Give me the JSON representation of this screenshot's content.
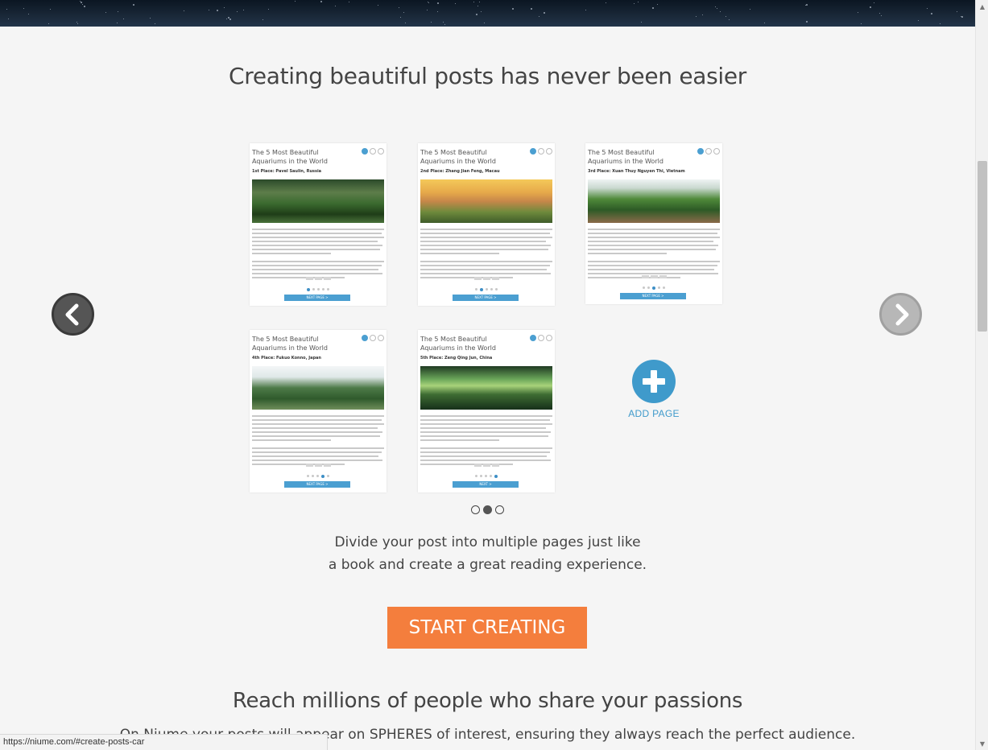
{
  "hero": {
    "label": ""
  },
  "main": {
    "title": "Creating beautiful posts has never been easier",
    "description_line1": "Divide your post into multiple pages just like",
    "description_line2": "a book and create a great reading experience.",
    "cta_label": "START CREATING",
    "add_page_label": "ADD PAGE"
  },
  "cards": [
    {
      "title": "The 5 Most Beautiful Aquariums in the World",
      "subtitle": "1st Place: Pavel Saulin, Russia",
      "button": "NEXT PAGE >",
      "active_dot": 0
    },
    {
      "title": "The 5 Most Beautiful Aquariums in the World",
      "subtitle": "2nd Place: Zhang Jian Feng, Macau",
      "button": "NEXT PAGE >",
      "active_dot": 1
    },
    {
      "title": "The 5 Most Beautiful Aquariums in the World",
      "subtitle": "3rd Place: Xuan Thuy Nguyen Thi, Vietnam",
      "button": "NEXT PAGE >",
      "active_dot": 2
    },
    {
      "title": "The 5 Most Beautiful Aquariums in the World",
      "subtitle": "4th Place: Fukuo Konno, Japan",
      "button": "NEXT PAGE >",
      "active_dot": 3
    },
    {
      "title": "The 5 Most Beautiful Aquariums in the World",
      "subtitle": "5th Place: Zeng Qing Jun, China",
      "button": "NEXT >",
      "active_dot": 4
    }
  ],
  "carousel": {
    "total_slides": 3,
    "active_slide": 1
  },
  "section2": {
    "title": "Reach millions of people who share your passions",
    "subtitle": "On Niume your posts will appear on SPHERES of interest, ensuring they always reach the perfect audience."
  },
  "status_bar": {
    "url": "https://niume.com/#create-posts-car"
  },
  "colors": {
    "accent_blue": "#3f9acb",
    "cta_orange": "#f47e3d",
    "background": "#f5f5f5"
  },
  "icons": [
    "chevron-left-icon",
    "chevron-right-icon",
    "plus-icon",
    "share-icon",
    "comment-icon",
    "settings-icon"
  ]
}
